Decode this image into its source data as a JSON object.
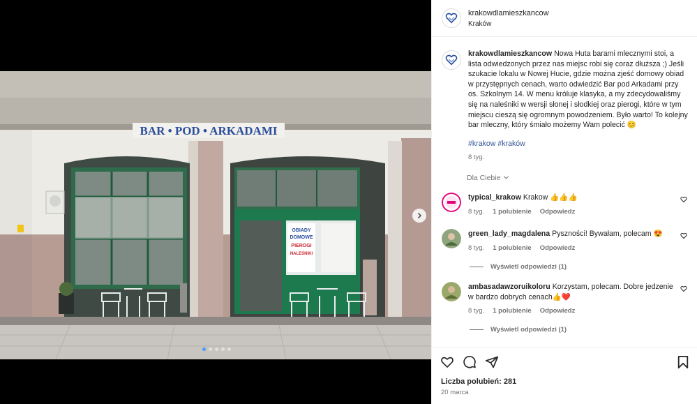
{
  "post": {
    "username": "krakowdlamieszkancow",
    "location": "Kraków",
    "caption": "Nowa Huta barami mlecznymi stoi, a lista odwiedzonych przez nas miejsc robi się coraz dłuższa ;) Jeśli szukacie lokalu w Nowej Hucie, gdzie można zjeść domowy obiad w przystępnych cenach, warto odwiedzić Bar pod Arkadami przy os. Szkolnym 14. W menu króluje klasyka, a my zdecydowaliśmy się na naleśniki w wersji słonej i słodkiej oraz pierogi, które w tym miejscu cieszą się ogromnym powodzeniem. Było warto! To kolejny bar mleczny, który śmiało możemy Wam polecić 😊",
    "hashtags": "#krakow #kraków",
    "caption_time": "8 tyg.",
    "for_you_label": "Dla Ciebie",
    "likes": "Liczba polubień: 281",
    "date": "20 marca"
  },
  "photo": {
    "sign_text": "BAR • POD • ARKADAMI",
    "menu_text_1": "OBIADY",
    "menu_text_2": "DOMOWE",
    "menu_text_3": "PIEROGI",
    "menu_text_4": "NALEŚNIKI"
  },
  "comments": [
    {
      "username": "typical_krakow",
      "text": "Krakow 👍👍👍",
      "time": "8 tyg.",
      "likes": "1 polubienie",
      "reply": "Odpowiedz",
      "avatar_color": "#e4007c"
    },
    {
      "username": "green_lady_magdalena",
      "text": "Pyszności! Bywałam, polecam 😍",
      "time": "8 tyg.",
      "likes": "1 polubienie",
      "reply": "Odpowiedz",
      "view_replies": "Wyświetl odpowiedzi (1)",
      "avatar_color": "#6b8e5a"
    },
    {
      "username": "ambasadawzoruikoloru",
      "text": "Korzystam, polecam. Dobre jedzenie w bardzo dobrych cenach👍❤️",
      "time": "8 tyg.",
      "likes": "1 polubienie",
      "reply": "Odpowiedz",
      "view_replies": "Wyświetl odpowiedzi (1)",
      "avatar_color": "#7a8f4e"
    }
  ],
  "colors": {
    "brand_blue": "#2a4e9b",
    "window_green": "#1d7a4f",
    "link_blue": "#385898"
  }
}
